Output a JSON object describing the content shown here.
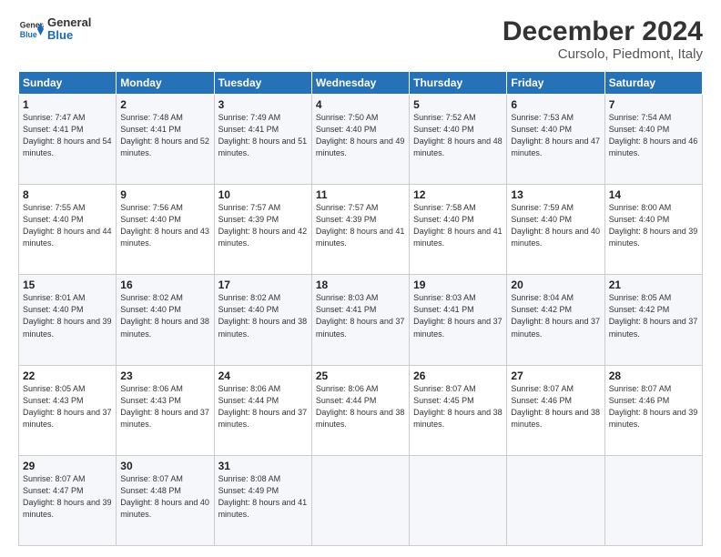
{
  "header": {
    "logo_line1": "General",
    "logo_line2": "Blue",
    "title": "December 2024",
    "subtitle": "Cursolo, Piedmont, Italy"
  },
  "columns": [
    "Sunday",
    "Monday",
    "Tuesday",
    "Wednesday",
    "Thursday",
    "Friday",
    "Saturday"
  ],
  "weeks": [
    [
      {
        "day": "1",
        "rise": "7:47 AM",
        "set": "4:41 PM",
        "daylight": "8 hours and 54 minutes."
      },
      {
        "day": "2",
        "rise": "7:48 AM",
        "set": "4:41 PM",
        "daylight": "8 hours and 52 minutes."
      },
      {
        "day": "3",
        "rise": "7:49 AM",
        "set": "4:41 PM",
        "daylight": "8 hours and 51 minutes."
      },
      {
        "day": "4",
        "rise": "7:50 AM",
        "set": "4:40 PM",
        "daylight": "8 hours and 49 minutes."
      },
      {
        "day": "5",
        "rise": "7:52 AM",
        "set": "4:40 PM",
        "daylight": "8 hours and 48 minutes."
      },
      {
        "day": "6",
        "rise": "7:53 AM",
        "set": "4:40 PM",
        "daylight": "8 hours and 47 minutes."
      },
      {
        "day": "7",
        "rise": "7:54 AM",
        "set": "4:40 PM",
        "daylight": "8 hours and 46 minutes."
      }
    ],
    [
      {
        "day": "8",
        "rise": "7:55 AM",
        "set": "4:40 PM",
        "daylight": "8 hours and 44 minutes."
      },
      {
        "day": "9",
        "rise": "7:56 AM",
        "set": "4:40 PM",
        "daylight": "8 hours and 43 minutes."
      },
      {
        "day": "10",
        "rise": "7:57 AM",
        "set": "4:39 PM",
        "daylight": "8 hours and 42 minutes."
      },
      {
        "day": "11",
        "rise": "7:57 AM",
        "set": "4:39 PM",
        "daylight": "8 hours and 41 minutes."
      },
      {
        "day": "12",
        "rise": "7:58 AM",
        "set": "4:40 PM",
        "daylight": "8 hours and 41 minutes."
      },
      {
        "day": "13",
        "rise": "7:59 AM",
        "set": "4:40 PM",
        "daylight": "8 hours and 40 minutes."
      },
      {
        "day": "14",
        "rise": "8:00 AM",
        "set": "4:40 PM",
        "daylight": "8 hours and 39 minutes."
      }
    ],
    [
      {
        "day": "15",
        "rise": "8:01 AM",
        "set": "4:40 PM",
        "daylight": "8 hours and 39 minutes."
      },
      {
        "day": "16",
        "rise": "8:02 AM",
        "set": "4:40 PM",
        "daylight": "8 hours and 38 minutes."
      },
      {
        "day": "17",
        "rise": "8:02 AM",
        "set": "4:40 PM",
        "daylight": "8 hours and 38 minutes."
      },
      {
        "day": "18",
        "rise": "8:03 AM",
        "set": "4:41 PM",
        "daylight": "8 hours and 37 minutes."
      },
      {
        "day": "19",
        "rise": "8:03 AM",
        "set": "4:41 PM",
        "daylight": "8 hours and 37 minutes."
      },
      {
        "day": "20",
        "rise": "8:04 AM",
        "set": "4:42 PM",
        "daylight": "8 hours and 37 minutes."
      },
      {
        "day": "21",
        "rise": "8:05 AM",
        "set": "4:42 PM",
        "daylight": "8 hours and 37 minutes."
      }
    ],
    [
      {
        "day": "22",
        "rise": "8:05 AM",
        "set": "4:43 PM",
        "daylight": "8 hours and 37 minutes."
      },
      {
        "day": "23",
        "rise": "8:06 AM",
        "set": "4:43 PM",
        "daylight": "8 hours and 37 minutes."
      },
      {
        "day": "24",
        "rise": "8:06 AM",
        "set": "4:44 PM",
        "daylight": "8 hours and 37 minutes."
      },
      {
        "day": "25",
        "rise": "8:06 AM",
        "set": "4:44 PM",
        "daylight": "8 hours and 38 minutes."
      },
      {
        "day": "26",
        "rise": "8:07 AM",
        "set": "4:45 PM",
        "daylight": "8 hours and 38 minutes."
      },
      {
        "day": "27",
        "rise": "8:07 AM",
        "set": "4:46 PM",
        "daylight": "8 hours and 38 minutes."
      },
      {
        "day": "28",
        "rise": "8:07 AM",
        "set": "4:46 PM",
        "daylight": "8 hours and 39 minutes."
      }
    ],
    [
      {
        "day": "29",
        "rise": "8:07 AM",
        "set": "4:47 PM",
        "daylight": "8 hours and 39 minutes."
      },
      {
        "day": "30",
        "rise": "8:07 AM",
        "set": "4:48 PM",
        "daylight": "8 hours and 40 minutes."
      },
      {
        "day": "31",
        "rise": "8:08 AM",
        "set": "4:49 PM",
        "daylight": "8 hours and 41 minutes."
      },
      null,
      null,
      null,
      null
    ]
  ],
  "labels": {
    "sunrise": "Sunrise:",
    "sunset": "Sunset:",
    "daylight": "Daylight:"
  }
}
